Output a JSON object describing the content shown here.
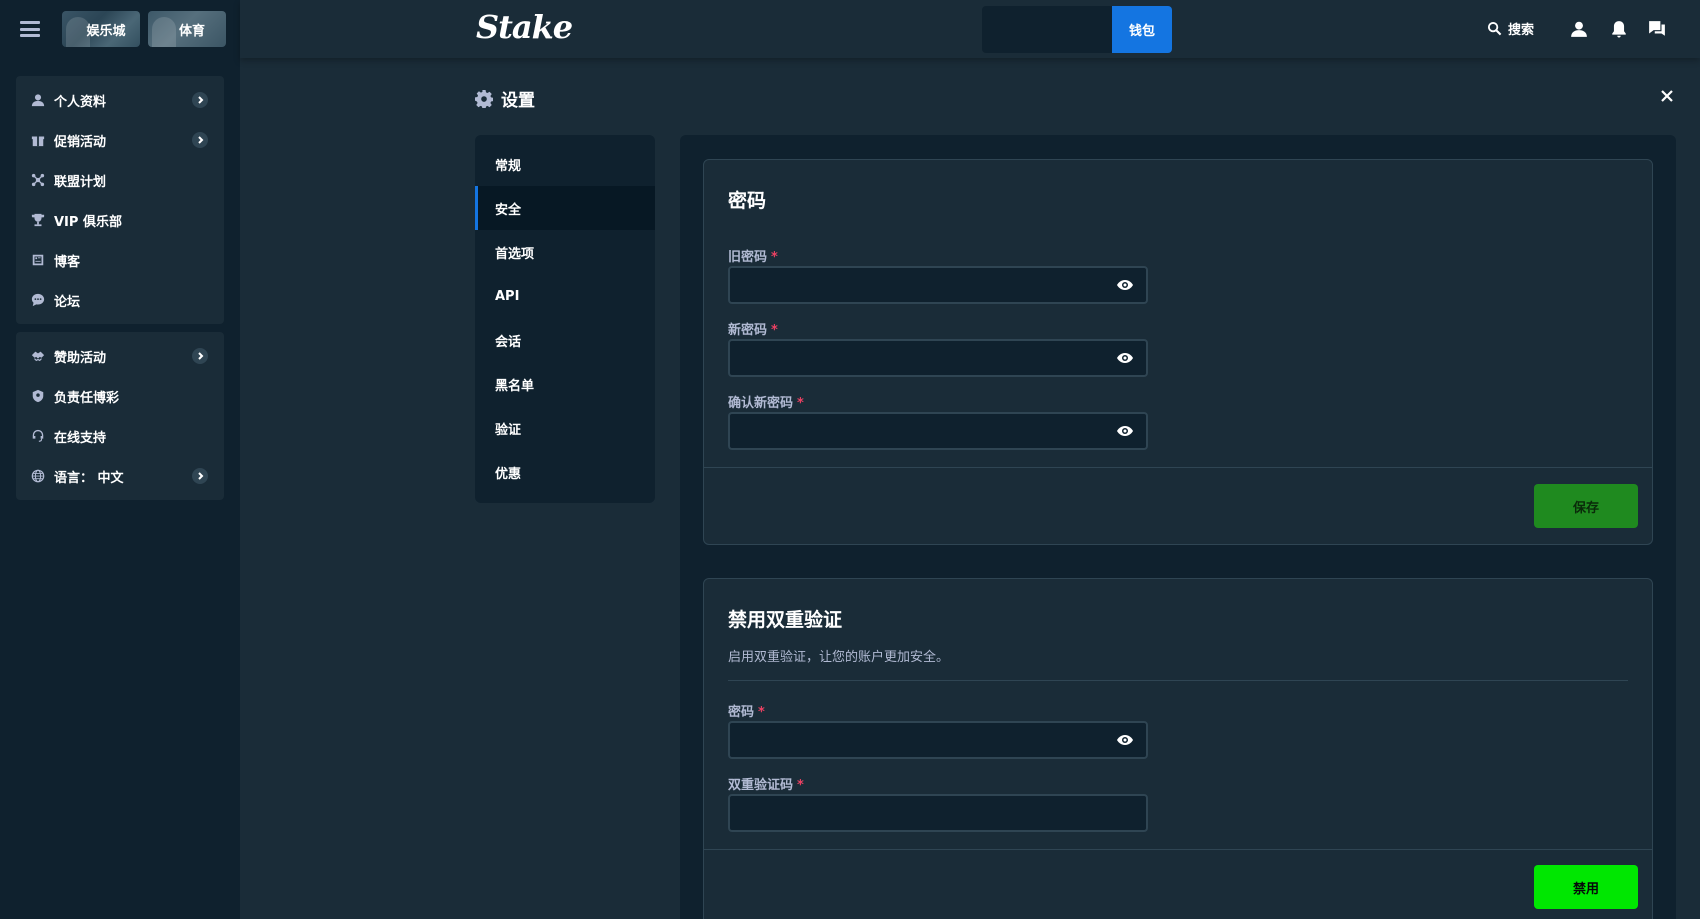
{
  "topbar": {
    "tabs": [
      {
        "label": "娱乐城"
      },
      {
        "label": "体育"
      }
    ],
    "logo": "Stake",
    "wallet_label": "钱包",
    "search_label": "搜索"
  },
  "sidebar": {
    "group1": [
      {
        "label": "个人资料",
        "icon": "user-icon",
        "has_chevron": true
      },
      {
        "label": "促销活动",
        "icon": "gift-icon",
        "has_chevron": true
      },
      {
        "label": "联盟计划",
        "icon": "affiliate-icon",
        "has_chevron": false
      },
      {
        "label": "VIP 俱乐部",
        "icon": "trophy-icon",
        "has_chevron": false
      },
      {
        "label": "博客",
        "icon": "blog-icon",
        "has_chevron": false
      },
      {
        "label": "论坛",
        "icon": "forum-icon",
        "has_chevron": false
      }
    ],
    "group2": [
      {
        "label": "赞助活动",
        "icon": "sponsorship-icon",
        "has_chevron": true
      },
      {
        "label": "负责任博彩",
        "icon": "shield-icon",
        "has_chevron": false
      },
      {
        "label": "在线支持",
        "icon": "headset-icon",
        "has_chevron": false
      },
      {
        "label": "语言：  中文",
        "icon": "globe-icon",
        "has_chevron": true
      }
    ]
  },
  "settings": {
    "title": "设置",
    "nav": [
      {
        "label": "常规"
      },
      {
        "label": "安全",
        "active": true
      },
      {
        "label": "首选项"
      },
      {
        "label": "API"
      },
      {
        "label": "会话"
      },
      {
        "label": "黑名单"
      },
      {
        "label": "验证"
      },
      {
        "label": "优惠"
      }
    ]
  },
  "password_card": {
    "title": "密码",
    "old_label": "旧密码",
    "new_label": "新密码",
    "confirm_label": "确认新密码",
    "required_mark": "*",
    "save_button": "保存"
  },
  "tfa_card": {
    "title": "禁用双重验证",
    "subtitle": "启用双重验证，让您的账户更加安全。",
    "password_label": "密码",
    "code_label": "双重验证码",
    "required_mark": "*",
    "disable_button": "禁用"
  },
  "colors": {
    "bg": "#1a2c38",
    "panel": "#0f212e",
    "accent_blue": "#1475e1",
    "accent_green": "#00e701",
    "required_red": "#ed4163"
  }
}
